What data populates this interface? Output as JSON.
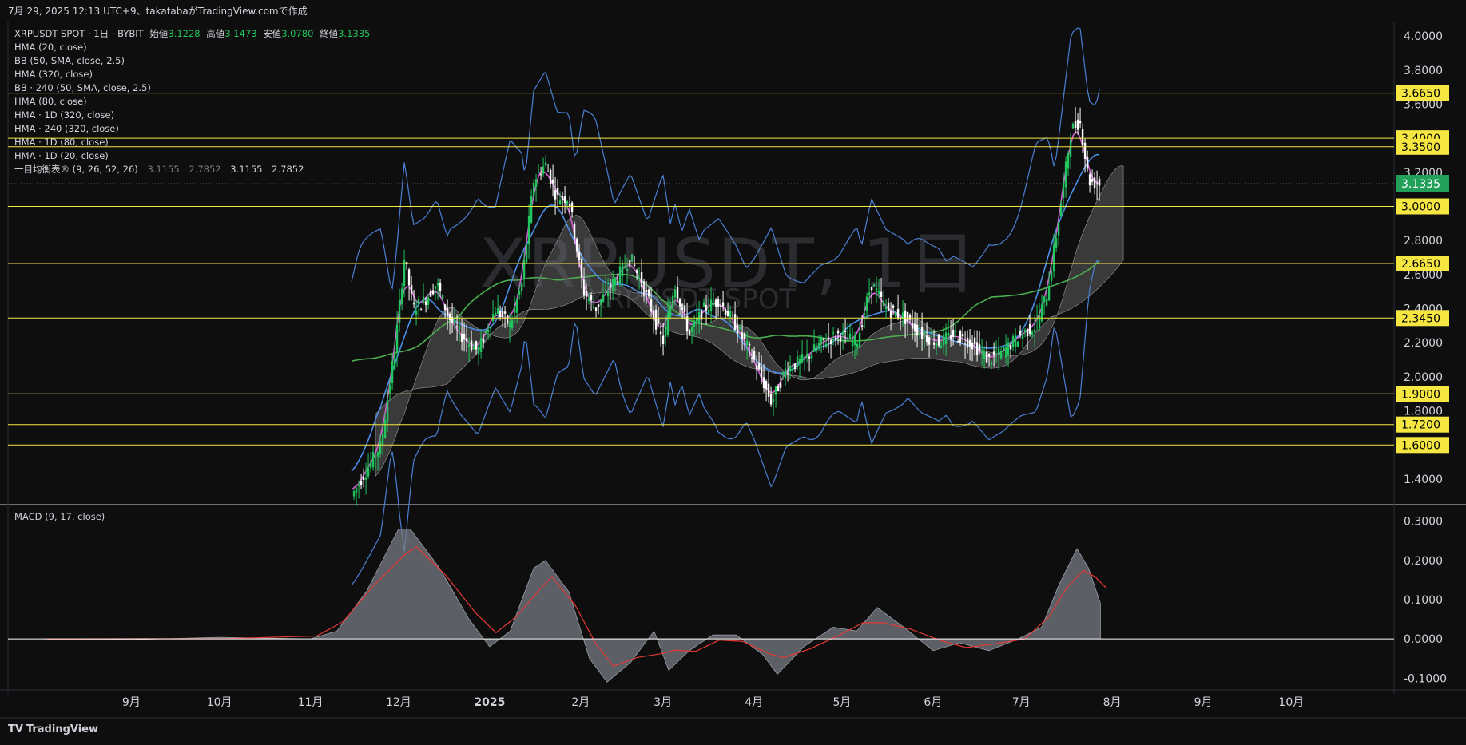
{
  "header": {
    "caption": "7月 29, 2025 12:13 UTC+9、takatabaがTradingView.comで作成"
  },
  "legend": {
    "symbol": "XRPUSDT SPOT · 1日 · BYBIT",
    "open_label": "始値",
    "open": "3.1228",
    "high_label": "高値",
    "high": "3.1473",
    "low_label": "安値",
    "low": "3.0780",
    "close_label": "終値",
    "close": "3.1335",
    "indicators": [
      "HMA (20, close)",
      "BB (50, SMA, close, 2.5)",
      "HMA (320, close)",
      "BB · 240 (50, SMA, close, 2.5)",
      "HMA (80, close)",
      "HMA · 1D (320, close)",
      "HMA · 240 (320, close)",
      "HMA · 1D (80, close)",
      "HMA · 1D (20, close)"
    ],
    "ichimoku": {
      "label": "一目均衡表® (9, 26, 52, 26)",
      "v1": "3.1155",
      "v2": "2.7852",
      "v3": "3.1155",
      "v4": "2.7852"
    }
  },
  "watermark": {
    "main": "XRPUSDT, 1日",
    "sub": "XRPUSDT SPOT"
  },
  "macd_legend": "MACD (9, 17, close)",
  "footer": {
    "logo": "TV",
    "brand": "TradingView"
  },
  "colors": {
    "background": "#0e0e0e",
    "bull": "#22c55e",
    "bear": "#ffffff",
    "hline": "#f5e642",
    "label_bg": "#f5e642",
    "current_price_bg": "#22a05a",
    "bb_line": "#4a7fd4",
    "hma_fast": "#d45fd4",
    "hma_mid": "#4a8fe8",
    "hma_slow": "#4caf50",
    "macd_fill": "#787b86",
    "signal": "#e53935"
  },
  "chart_data": {
    "type": "candlestick",
    "price_axis": {
      "ticks": [
        "4.0000",
        "3.8000",
        "3.6000",
        "3.4000",
        "3.2000",
        "3.0000",
        "2.8000",
        "2.6000",
        "2.4000",
        "2.2000",
        "2.0000",
        "1.8000",
        "1.6000",
        "1.4000"
      ],
      "range": [
        1.25,
        4.08
      ]
    },
    "horizontal_levels": [
      {
        "value": 3.665,
        "label": "3.6650"
      },
      {
        "value": 3.4,
        "label": "3.4000"
      },
      {
        "value": 3.35,
        "label": "3.3500"
      },
      {
        "value": 3.0,
        "label": "3.0000"
      },
      {
        "value": 2.665,
        "label": "2.6650"
      },
      {
        "value": 2.345,
        "label": "2.3450"
      },
      {
        "value": 1.9,
        "label": "1.9000"
      },
      {
        "value": 1.72,
        "label": "1.7200"
      },
      {
        "value": 1.6,
        "label": "1.6000"
      }
    ],
    "current_price": {
      "value": 3.1335,
      "label": "3.1335"
    },
    "time_axis": {
      "labels": [
        "9月",
        "10月",
        "11月",
        "12月",
        "2025",
        "2月",
        "3月",
        "4月",
        "5月",
        "6月",
        "7月",
        "8月",
        "9月",
        "10月"
      ],
      "bold": [
        "2025"
      ]
    },
    "price_path": [
      [
        "2024-11-15",
        1.3
      ],
      [
        "2024-11-20",
        1.45
      ],
      [
        "2024-11-25",
        1.6
      ],
      [
        "2024-11-30",
        2.2
      ],
      [
        "2024-12-03",
        2.7
      ],
      [
        "2024-12-06",
        2.4
      ],
      [
        "2024-12-10",
        2.45
      ],
      [
        "2024-12-14",
        2.55
      ],
      [
        "2024-12-18",
        2.35
      ],
      [
        "2024-12-22",
        2.25
      ],
      [
        "2024-12-28",
        2.15
      ],
      [
        "2025-01-03",
        2.4
      ],
      [
        "2025-01-08",
        2.3
      ],
      [
        "2025-01-12",
        2.55
      ],
      [
        "2025-01-16",
        3.15
      ],
      [
        "2025-01-20",
        3.25
      ],
      [
        "2025-01-24",
        3.05
      ],
      [
        "2025-01-28",
        3.05
      ],
      [
        "2025-02-02",
        2.5
      ],
      [
        "2025-02-06",
        2.4
      ],
      [
        "2025-02-12",
        2.55
      ],
      [
        "2025-02-18",
        2.7
      ],
      [
        "2025-02-24",
        2.45
      ],
      [
        "2025-03-01",
        2.2
      ],
      [
        "2025-03-05",
        2.55
      ],
      [
        "2025-03-10",
        2.25
      ],
      [
        "2025-03-15",
        2.4
      ],
      [
        "2025-03-20",
        2.45
      ],
      [
        "2025-03-26",
        2.3
      ],
      [
        "2025-04-01",
        2.1
      ],
      [
        "2025-04-07",
        1.85
      ],
      [
        "2025-04-12",
        2.05
      ],
      [
        "2025-04-18",
        2.1
      ],
      [
        "2025-04-24",
        2.2
      ],
      [
        "2025-04-30",
        2.25
      ],
      [
        "2025-05-06",
        2.2
      ],
      [
        "2025-05-11",
        2.55
      ],
      [
        "2025-05-16",
        2.4
      ],
      [
        "2025-05-22",
        2.35
      ],
      [
        "2025-05-28",
        2.25
      ],
      [
        "2025-06-03",
        2.2
      ],
      [
        "2025-06-08",
        2.25
      ],
      [
        "2025-06-14",
        2.2
      ],
      [
        "2025-06-20",
        2.1
      ],
      [
        "2025-06-25",
        2.15
      ],
      [
        "2025-07-01",
        2.25
      ],
      [
        "2025-07-06",
        2.3
      ],
      [
        "2025-07-10",
        2.5
      ],
      [
        "2025-07-14",
        2.95
      ],
      [
        "2025-07-18",
        3.45
      ],
      [
        "2025-07-21",
        3.5
      ],
      [
        "2025-07-24",
        3.15
      ],
      [
        "2025-07-28",
        3.13
      ]
    ],
    "macd_axis": {
      "ticks": [
        "0.3000",
        "0.2000",
        "0.1000",
        "0.0000",
        "-0.1000"
      ],
      "range": [
        -0.13,
        0.34
      ]
    },
    "macd_path": [
      [
        "2024-08-01",
        0.0
      ],
      [
        "2024-09-01",
        -0.002
      ],
      [
        "2024-10-01",
        0.004
      ],
      [
        "2024-11-01",
        0.0
      ],
      [
        "2024-11-10",
        0.02
      ],
      [
        "2024-11-20",
        0.12
      ],
      [
        "2024-12-01",
        0.28
      ],
      [
        "2024-12-05",
        0.28
      ],
      [
        "2024-12-15",
        0.18
      ],
      [
        "2024-12-25",
        0.05
      ],
      [
        "2025-01-01",
        -0.02
      ],
      [
        "2025-01-08",
        0.02
      ],
      [
        "2025-01-16",
        0.18
      ],
      [
        "2025-01-20",
        0.2
      ],
      [
        "2025-01-28",
        0.12
      ],
      [
        "2025-02-04",
        -0.05
      ],
      [
        "2025-02-10",
        -0.11
      ],
      [
        "2025-02-18",
        -0.06
      ],
      [
        "2025-02-26",
        0.02
      ],
      [
        "2025-03-03",
        -0.08
      ],
      [
        "2025-03-10",
        -0.03
      ],
      [
        "2025-03-18",
        0.01
      ],
      [
        "2025-03-26",
        0.01
      ],
      [
        "2025-04-04",
        -0.04
      ],
      [
        "2025-04-09",
        -0.09
      ],
      [
        "2025-04-18",
        -0.02
      ],
      [
        "2025-04-28",
        0.03
      ],
      [
        "2025-05-06",
        0.02
      ],
      [
        "2025-05-13",
        0.08
      ],
      [
        "2025-05-22",
        0.03
      ],
      [
        "2025-06-01",
        -0.03
      ],
      [
        "2025-06-10",
        -0.01
      ],
      [
        "2025-06-20",
        -0.03
      ],
      [
        "2025-06-30",
        0.0
      ],
      [
        "2025-07-08",
        0.03
      ],
      [
        "2025-07-14",
        0.14
      ],
      [
        "2025-07-20",
        0.23
      ],
      [
        "2025-07-24",
        0.18
      ],
      [
        "2025-07-28",
        0.09
      ]
    ],
    "grid": false,
    "legend_position": "top-left"
  }
}
